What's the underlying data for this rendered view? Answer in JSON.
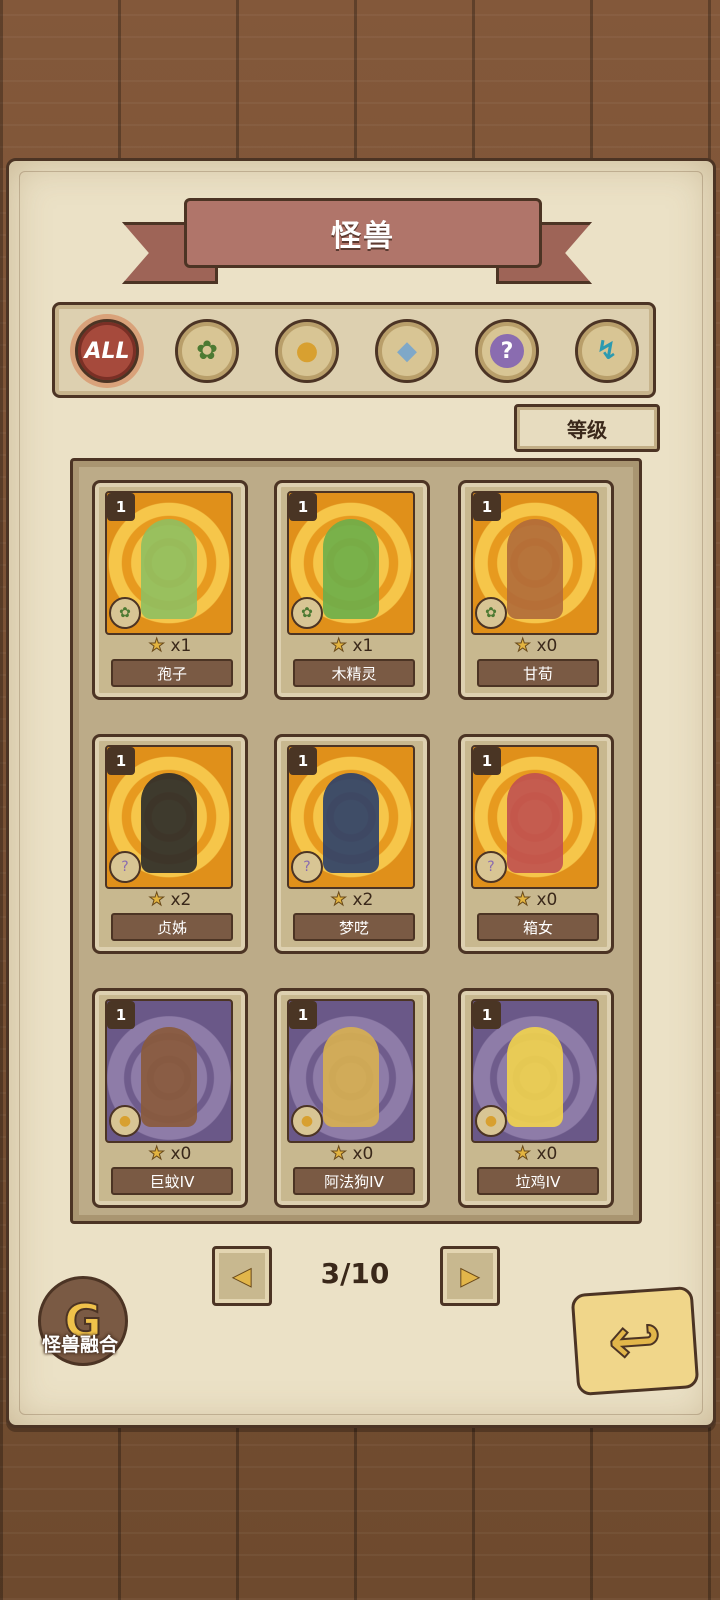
{
  "header": {
    "title": "怪兽"
  },
  "categories": [
    {
      "id": "all",
      "label": "ALL",
      "active": true
    },
    {
      "id": "plant",
      "icon": "leaf-icon"
    },
    {
      "id": "beast",
      "icon": "paw-icon"
    },
    {
      "id": "crystal",
      "icon": "crystal-icon"
    },
    {
      "id": "mystery",
      "icon": "question-icon",
      "glyph": "?"
    },
    {
      "id": "tech",
      "icon": "tech-icon"
    }
  ],
  "sort": {
    "label": "等级"
  },
  "cards": [
    {
      "level": "1",
      "count": "x1",
      "name": "孢子",
      "element": "leaf-icon",
      "bg": "gold"
    },
    {
      "level": "1",
      "count": "x1",
      "name": "木精灵",
      "element": "leaf-icon",
      "bg": "gold"
    },
    {
      "level": "1",
      "count": "x0",
      "name": "甘荀",
      "element": "leaf-icon",
      "bg": "gold"
    },
    {
      "level": "1",
      "count": "x2",
      "name": "贞姊",
      "element": "question-icon",
      "bg": "gold"
    },
    {
      "level": "1",
      "count": "x2",
      "name": "梦呓",
      "element": "question-icon",
      "bg": "gold"
    },
    {
      "level": "1",
      "count": "x0",
      "name": "箱女",
      "element": "question-icon",
      "bg": "gold"
    },
    {
      "level": "1",
      "count": "x0",
      "name": "巨蚊IV",
      "element": "paw-icon",
      "bg": "purple"
    },
    {
      "level": "1",
      "count": "x0",
      "name": "阿法狗IV",
      "element": "paw-icon",
      "bg": "purple"
    },
    {
      "level": "1",
      "count": "x0",
      "name": "垃鸡IV",
      "element": "paw-icon",
      "bg": "purple"
    }
  ],
  "pager": {
    "text": "3/10",
    "prev_glyph": "◀",
    "next_glyph": "▶"
  },
  "footer": {
    "fusion_label": "怪兽融合"
  },
  "colors": {
    "accent": "#a64a3c",
    "gold_bg": "#f0b33a",
    "purple_bg": "#7d6a98",
    "ink": "#4c3424"
  }
}
